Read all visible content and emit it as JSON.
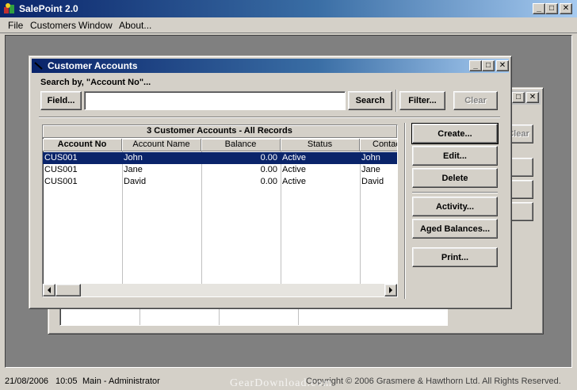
{
  "app": {
    "title": "SalePoint 2.0",
    "menu": [
      "File",
      "Customers",
      "Window",
      "About..."
    ]
  },
  "caption_buttons": {
    "minimize": "_",
    "maximize": "□",
    "close": "✕"
  },
  "back_window": {
    "clear_label": "Clear"
  },
  "dialog": {
    "title": "Customer Accounts",
    "search_label": "Search by, \"Account No\"...",
    "field_button": "Field...",
    "search_value": "",
    "search_button": "Search",
    "filter_button": "Filter...",
    "clear_button": "Clear",
    "grid_caption": "3 Customer Accounts - All Records",
    "columns": [
      "Account No",
      "Account Name",
      "Balance",
      "Status",
      "Contact"
    ],
    "rows": [
      [
        "CUS001",
        "John",
        "0.00",
        "Active",
        "John"
      ],
      [
        "CUS001",
        "Jane",
        "0.00",
        "Active",
        "Jane"
      ],
      [
        "CUS001",
        "David",
        "0.00",
        "Active",
        "David"
      ]
    ],
    "actions": {
      "create": "Create...",
      "edit": "Edit...",
      "delete": "Delete",
      "activity": "Activity...",
      "aged_balances": "Aged Balances...",
      "print": "Print..."
    }
  },
  "status": {
    "date": "21/08/2006",
    "time": "10:05",
    "user": "Main - Administrator",
    "copyright": "Copyright © 2006 Grasmere & Hawthorn Ltd. All Rights Reserved."
  },
  "watermark": "GearDownload.com"
}
